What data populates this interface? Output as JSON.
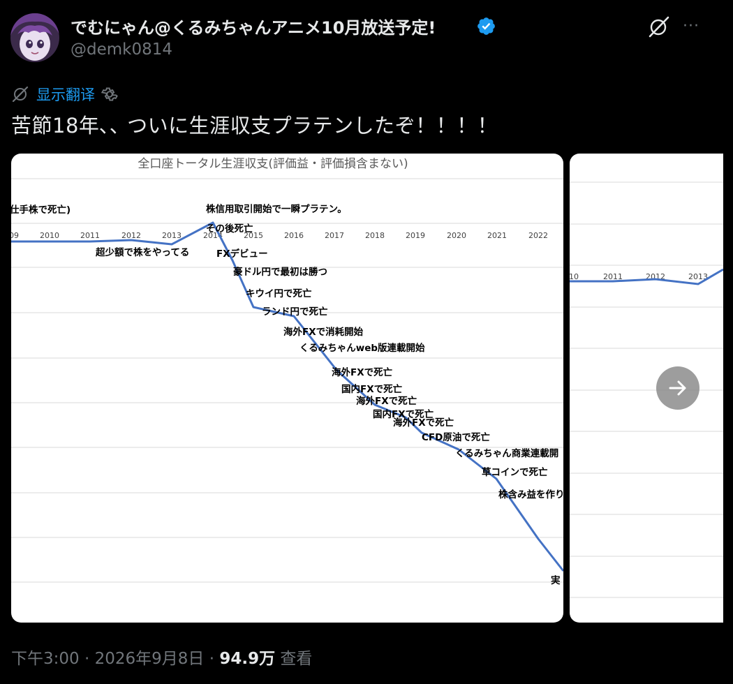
{
  "author": {
    "display_name": "でむにゃん@くるみちゃんアニメ10月放送予定!",
    "handle": "@demk0814",
    "verified": true,
    "avatar_icon": "avatar-anime-girl"
  },
  "header_actions": {
    "grok_icon": "grok-icon",
    "more_icon": "more-icon",
    "more_label": "···"
  },
  "translate": {
    "label": "显示翻译",
    "icon": "translate-icon",
    "settings_icon": "gear-icon"
  },
  "tweet": {
    "text": "苦節18年､､ ついに生涯収支プラテンしたぞ！！！！"
  },
  "media_1": {
    "title": "全口座トータル生涯収支(評価益・評価損含まない)",
    "axis_years": [
      "09",
      "2010",
      "2011",
      "2012",
      "2013",
      "2014",
      "2015",
      "2016",
      "2017",
      "2018",
      "2019",
      "2020",
      "2021",
      "2022"
    ],
    "annotations": [
      "仕手株で死亡)",
      "株信用取引開始で一瞬プラテン。",
      "その後死亡",
      "超少額で株をやってる",
      "FXデビュー",
      "豪ドル円で最初は勝つ",
      "キウイ円で死亡",
      "ランド円で死亡",
      "海外FXで消耗開始",
      "くるみちゃんweb版連載開始",
      "海外FXで死亡",
      "国内FXで死亡",
      "海外FXで死亡",
      "国内FXで死亡",
      "海外FXで死亡",
      "CFD原油で死亡",
      "くるみちゃん商業連載開",
      "草コインで死亡",
      "株含み益を作り",
      "実"
    ],
    "line_color": "#4472c4"
  },
  "media_2": {
    "axis_years": [
      "10",
      "2011",
      "2012",
      "2013"
    ],
    "line_color": "#4472c4"
  },
  "carousel": {
    "next_icon": "arrow-right-icon"
  },
  "meta": {
    "time": "下午3:00",
    "sep1": " · ",
    "date": "2026年9月8日",
    "sep2": " · ",
    "views": "94.9万",
    "views_label": " 查看"
  },
  "colors": {
    "background": "#000000",
    "text_primary": "#e7e9ea",
    "text_secondary": "#71767b",
    "link": "#1d9bf0",
    "verified_badge": "#1d9bf0"
  }
}
